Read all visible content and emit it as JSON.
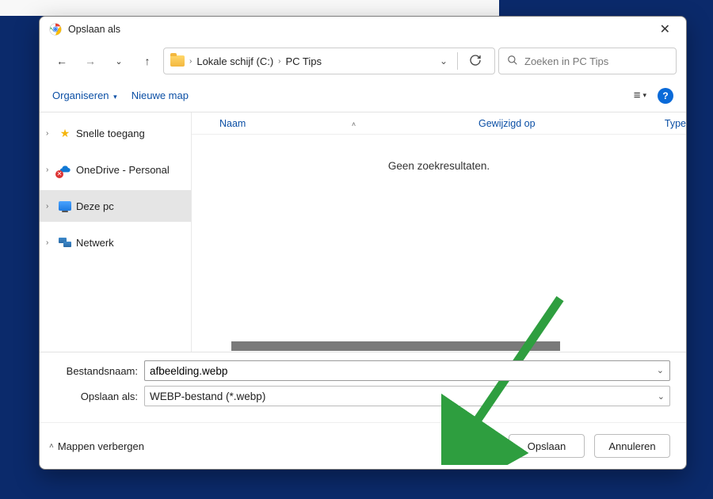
{
  "title": "Opslaan als",
  "breadcrumb": {
    "root": "Lokale schijf (C:)",
    "current": "PC Tips"
  },
  "search": {
    "placeholder": "Zoeken in PC Tips"
  },
  "toolbar": {
    "organize": "Organiseren",
    "newfolder": "Nieuwe map"
  },
  "sidebar": {
    "quick": "Snelle toegang",
    "onedrive": "OneDrive - Personal",
    "thispc": "Deze pc",
    "network": "Netwerk"
  },
  "columns": {
    "name": "Naam",
    "date": "Gewijzigd op",
    "type": "Type"
  },
  "empty_msg": "Geen zoekresultaten.",
  "form": {
    "filename_label": "Bestandsnaam:",
    "filetype_label": "Opslaan als:",
    "filename_value": "afbeelding.webp",
    "filetype_value": "WEBP-bestand (*.webp)"
  },
  "footer": {
    "hide_folders": "Mappen verbergen",
    "save": "Opslaan",
    "cancel": "Annuleren"
  }
}
